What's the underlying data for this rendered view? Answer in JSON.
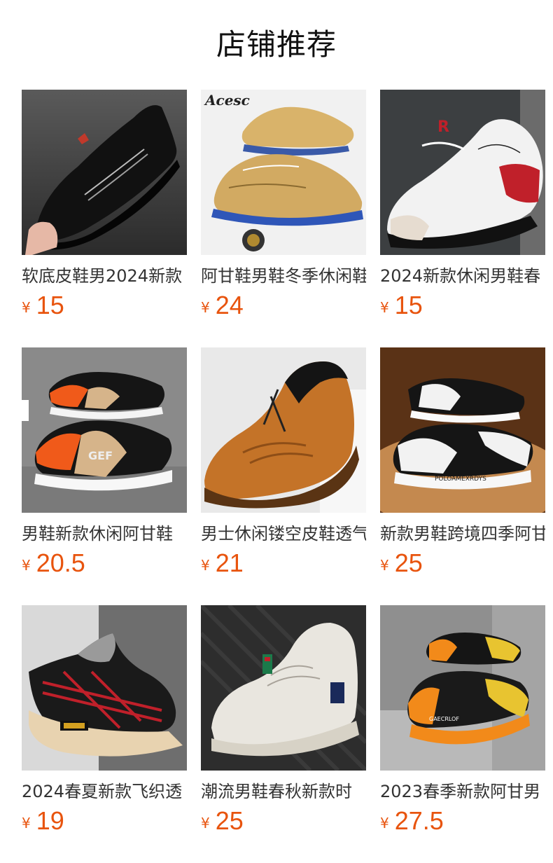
{
  "section_title": "店铺推荐",
  "currency_symbol": "¥",
  "colors": {
    "price": "#e8540e",
    "title": "#111111",
    "name": "#333333"
  },
  "products": [
    {
      "name": "软底皮鞋男2024新款",
      "price": "15",
      "image_icon": "black-leather-shoe-icon"
    },
    {
      "name": "阿甘鞋男鞋冬季休闲鞋",
      "price": "24",
      "image_icon": "khaki-sneaker-icon"
    },
    {
      "name": "2024新款休闲男鞋春",
      "price": "15",
      "image_icon": "white-sneaker-icon"
    },
    {
      "name": "男鞋新款休闲阿甘鞋",
      "price": "20.5",
      "image_icon": "black-orange-sneaker-icon"
    },
    {
      "name": "男士休闲镂空皮鞋透气",
      "price": "21",
      "image_icon": "brown-leather-shoe-icon"
    },
    {
      "name": "新款男鞋跨境四季阿甘",
      "price": "25",
      "image_icon": "black-white-sneaker-icon"
    },
    {
      "name": "2024春夏新款飞织透",
      "price": "19",
      "image_icon": "knit-slip-on-icon"
    },
    {
      "name": "潮流男鞋春秋新款时",
      "price": "25",
      "image_icon": "white-skate-shoe-icon"
    },
    {
      "name": "2023春季新款阿甘男",
      "price": "27.5",
      "image_icon": "orange-black-sneaker-icon"
    }
  ]
}
